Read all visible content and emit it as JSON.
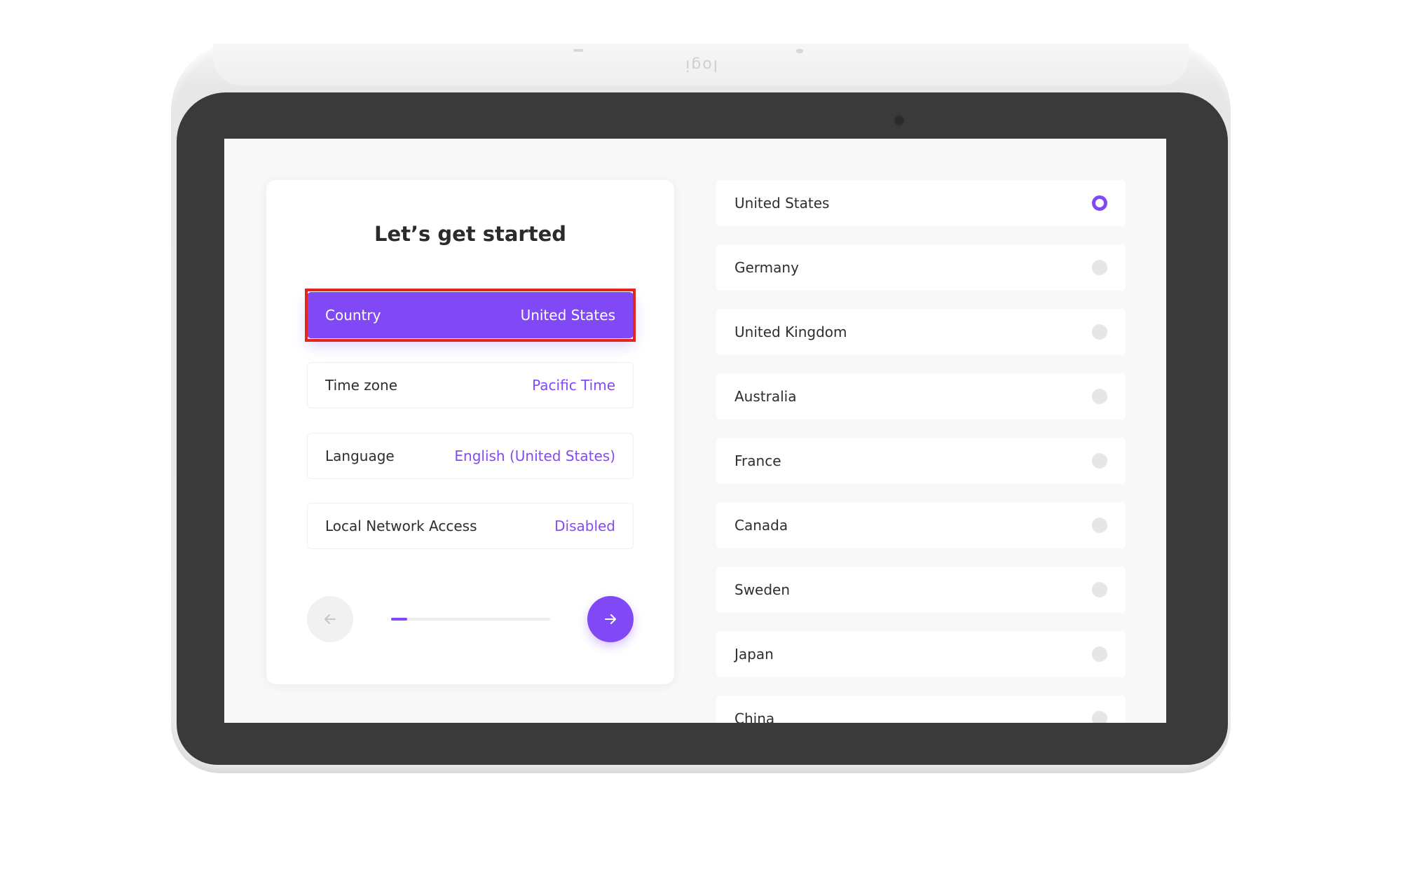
{
  "device": {
    "logo_text": "logi"
  },
  "setup": {
    "title": "Let’s get started",
    "rows": [
      {
        "label": "Country",
        "value": "United States"
      },
      {
        "label": "Time zone",
        "value": "Pacific Time"
      },
      {
        "label": "Language",
        "value": "English (United States)"
      },
      {
        "label": "Local Network Access",
        "value": "Disabled"
      }
    ],
    "active_row": "Country",
    "progress_fraction": 0.1,
    "back_icon": "arrow-left-icon",
    "next_icon": "arrow-right-icon"
  },
  "countries": {
    "selected": "United States",
    "items": [
      {
        "name": "United States",
        "selected": true
      },
      {
        "name": "Germany",
        "selected": false
      },
      {
        "name": "United Kingdom",
        "selected": false
      },
      {
        "name": "Australia",
        "selected": false
      },
      {
        "name": "France",
        "selected": false
      },
      {
        "name": "Canada",
        "selected": false
      },
      {
        "name": "Sweden",
        "selected": false
      },
      {
        "name": "Japan",
        "selected": false
      },
      {
        "name": "China",
        "selected": false
      }
    ]
  },
  "colors": {
    "accent": "#8149f5",
    "highlight": "#e3261b",
    "bezel": "#3a3a3a"
  }
}
